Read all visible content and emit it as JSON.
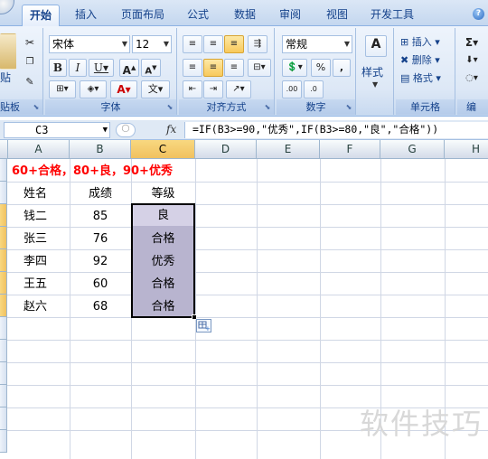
{
  "tabs": [
    "开始",
    "插入",
    "页面布局",
    "公式",
    "数据",
    "审阅",
    "视图",
    "开发工具"
  ],
  "ribbon": {
    "clipboard": {
      "label": "贴板",
      "paste_label": "贴"
    },
    "font": {
      "label": "字体",
      "font_name": "宋体",
      "font_size": "12"
    },
    "alignment": {
      "label": "对齐方式"
    },
    "number": {
      "label": "数字",
      "format": "常规"
    },
    "styles": {
      "label": "样式"
    },
    "cells": {
      "label": "单元格",
      "insert": "插入",
      "delete": "删除",
      "format": "格式"
    },
    "editing": {
      "label": "编"
    }
  },
  "formula_bar": {
    "name_box": "C3",
    "fx": "fx",
    "formula": "=IF(B3>=90,\"优秀\",IF(B3>=80,\"良\",\"合格\"))"
  },
  "columns": [
    "A",
    "B",
    "C",
    "D",
    "E",
    "F",
    "G",
    "H"
  ],
  "sheet": {
    "note": "60+合格，80+良，90+优秀",
    "headers": [
      "姓名",
      "成绩",
      "等级"
    ],
    "rows": [
      {
        "name": "钱二",
        "score": "85",
        "grade": "良"
      },
      {
        "name": "张三",
        "score": "76",
        "grade": "合格"
      },
      {
        "name": "李四",
        "score": "92",
        "grade": "优秀"
      },
      {
        "name": "王五",
        "score": "60",
        "grade": "合格"
      },
      {
        "name": "赵六",
        "score": "68",
        "grade": "合格"
      }
    ]
  },
  "watermark": "软件技巧",
  "colors": {
    "selection_fill": "#b8b4cf",
    "header_selected": "#f1c15f",
    "note_red": "#ff0000"
  }
}
